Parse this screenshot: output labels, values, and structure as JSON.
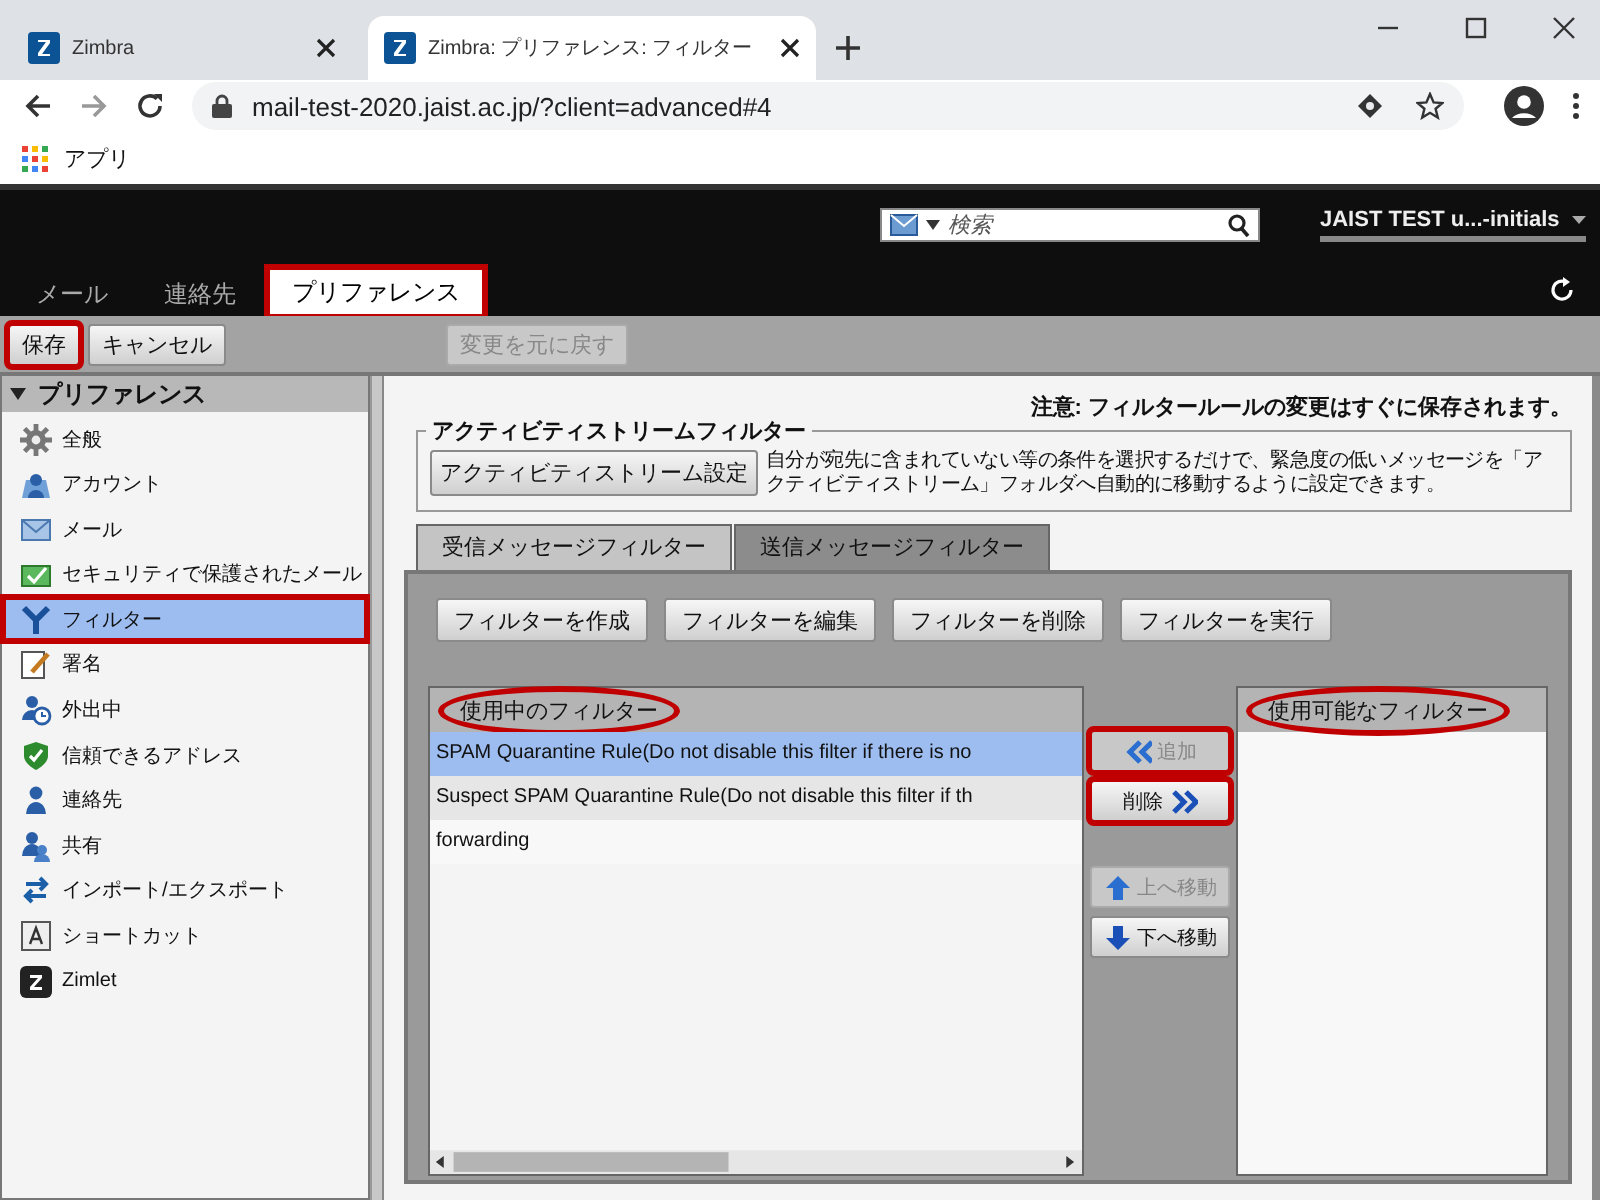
{
  "browser": {
    "tabs": [
      {
        "title": "Zimbra",
        "selected": false
      },
      {
        "title": "Zimbra: プリファレンス: フィルター",
        "selected": true
      }
    ],
    "url": "mail-test-2020.jaist.ac.jp/?client=advanced#4",
    "bookmarks": [
      {
        "label": "アプリ"
      }
    ]
  },
  "header": {
    "search": {
      "placeholder": "検索"
    },
    "user": "JAIST TEST u...-initials"
  },
  "nav_tabs": [
    {
      "label": "メール",
      "selected": false,
      "highlighted": false
    },
    {
      "label": "連絡先",
      "selected": false,
      "highlighted": false
    },
    {
      "label": "プリファレンス",
      "selected": true,
      "highlighted": true
    }
  ],
  "toolbar": [
    {
      "label": "保存",
      "disabled": false,
      "highlighted": true
    },
    {
      "label": "キャンセル",
      "disabled": false,
      "highlighted": false
    },
    {
      "label": "変更を元に戻す",
      "disabled": true,
      "highlighted": false
    }
  ],
  "sidebar": {
    "title": "プリファレンス",
    "expanded": true,
    "items": [
      {
        "label": "全般",
        "selected": false,
        "highlighted": false
      },
      {
        "label": "アカウント",
        "selected": false,
        "highlighted": false
      },
      {
        "label": "メール",
        "selected": false,
        "highlighted": false
      },
      {
        "label": "セキュリティで保護されたメール",
        "selected": false,
        "highlighted": false
      },
      {
        "label": "フィルター",
        "selected": true,
        "highlighted": true
      },
      {
        "label": "署名",
        "selected": false,
        "highlighted": false
      },
      {
        "label": "外出中",
        "selected": false,
        "highlighted": false
      },
      {
        "label": "信頼できるアドレス",
        "selected": false,
        "highlighted": false
      },
      {
        "label": "連絡先",
        "selected": false,
        "highlighted": false
      },
      {
        "label": "共有",
        "selected": false,
        "highlighted": false
      },
      {
        "label": "インポート/エクスポート",
        "selected": false,
        "highlighted": false
      },
      {
        "label": "ショートカット",
        "selected": false,
        "highlighted": false
      },
      {
        "label": "Zimlet",
        "selected": false,
        "highlighted": false
      }
    ]
  },
  "notice": "注意: フィルタールールの変更はすぐに保存されます。",
  "activity_stream": {
    "legend": "アクティビティストリームフィルター",
    "button": "アクティビティストリーム設定",
    "description": "自分が宛先に含まれていない等の条件を選択するだけで、緊急度の低いメッセージを「アクティビティストリーム」フォルダへ自動的に移動するように設定できます。"
  },
  "filter_tabs": [
    {
      "label": "受信メッセージフィルター",
      "selected": true
    },
    {
      "label": "送信メッセージフィルター",
      "selected": false
    }
  ],
  "filter_buttons": [
    "フィルターを作成",
    "フィルターを編集",
    "フィルターを削除",
    "フィルターを実行"
  ],
  "active_filters": {
    "title": "使用中のフィルター",
    "circled": true,
    "rows": [
      {
        "text": "SPAM Quarantine Rule(Do not disable this filter if there is no",
        "selected": true
      },
      {
        "text": "Suspect SPAM Quarantine Rule(Do not disable this filter if th",
        "selected": false
      },
      {
        "text": "forwarding",
        "selected": false
      }
    ]
  },
  "move_buttons": [
    {
      "label": "追加",
      "kind": "add",
      "disabled": true,
      "highlighted": true
    },
    {
      "label": "削除",
      "kind": "remove",
      "disabled": false,
      "highlighted": true
    },
    {
      "label": "上へ移動",
      "kind": "up",
      "disabled": true,
      "highlighted": false
    },
    {
      "label": "下へ移動",
      "kind": "down",
      "disabled": false,
      "highlighted": false
    }
  ],
  "available_filters": {
    "title": "使用可能なフィルター",
    "circled": true
  }
}
